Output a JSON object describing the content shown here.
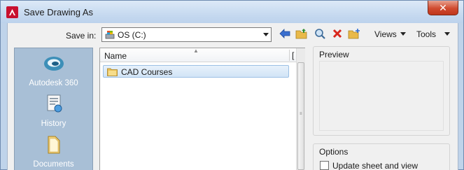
{
  "window": {
    "title": "Save Drawing As",
    "close_glyph": "✕",
    "app_icon": "autocad-a-icon"
  },
  "toolbar": {
    "save_in_label": "Save in:",
    "location": "OS (C:)",
    "location_icon": "drive-icon",
    "tools": [
      "back-arrow-icon",
      "up-folder-icon",
      "search-web-icon",
      "delete-icon",
      "new-folder-icon"
    ],
    "views_label": "Views",
    "tools_label": "Tools"
  },
  "places": [
    {
      "label": "Autodesk 360",
      "icon": "cloud-icon"
    },
    {
      "label": "History",
      "icon": "history-icon"
    },
    {
      "label": "Documents",
      "icon": "documents-icon"
    }
  ],
  "file_list": {
    "columns": [
      "Name",
      "["
    ],
    "rows": [
      {
        "label": "CAD Courses",
        "icon": "folder-icon",
        "selected": true
      }
    ]
  },
  "preview": {
    "title": "Preview"
  },
  "options": {
    "title": "Options",
    "update_sheet_label": "Update sheet and view",
    "update_sheet_checked": false
  },
  "colors": {
    "sidebar": "#a8bfd6",
    "close": "#c8402a",
    "accent": "#c8102e"
  }
}
